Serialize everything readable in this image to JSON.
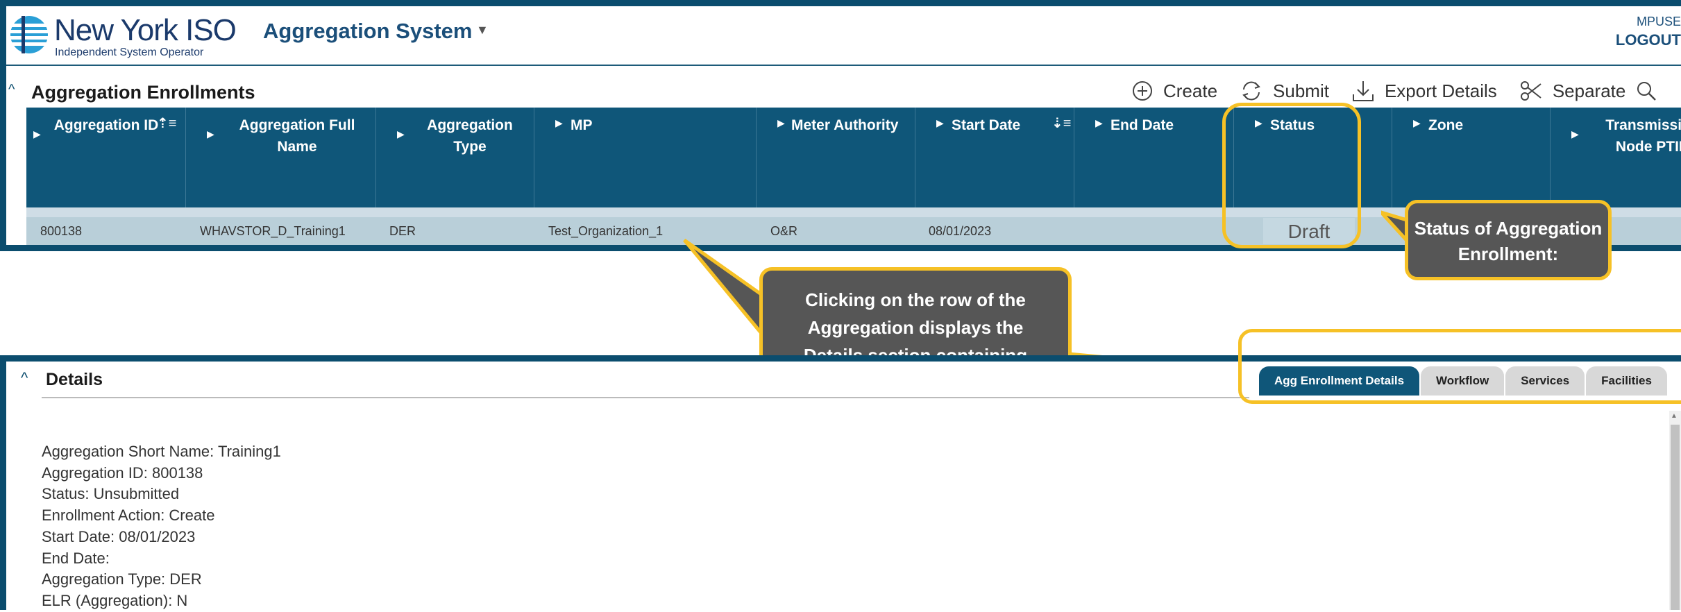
{
  "header": {
    "logo_title": "New York ISO",
    "logo_subtitle": "Independent System Operator",
    "app_title": "Aggregation System",
    "user": "MPUSE",
    "logout": "LOGOUT"
  },
  "enrollments": {
    "title": "Aggregation Enrollments",
    "toolbar": {
      "create": "Create",
      "submit": "Submit",
      "export": "Export Details",
      "separate": "Separate"
    },
    "columns": [
      {
        "label": "Aggregation ID"
      },
      {
        "label": "Aggregation Full Name"
      },
      {
        "label": "Aggregation Type"
      },
      {
        "label": "MP"
      },
      {
        "label": "Meter Authority"
      },
      {
        "label": "Start Date"
      },
      {
        "label": "End Date"
      },
      {
        "label": "Status"
      },
      {
        "label": "Zone"
      },
      {
        "label": "Transmission Node PTID"
      }
    ],
    "row": {
      "id": "800138",
      "full_name": "WHAVSTOR_D_Training1",
      "type": "DER",
      "mp": "Test_Organization_1",
      "meter_authority": "O&R",
      "start_date": "08/01/2023",
      "end_date": "",
      "status": "Draft"
    }
  },
  "callouts": {
    "status": "Status of Aggregation Enrollment:",
    "row_click": "Clicking on  the row of the Aggregation displays the Details section containing Aggregation level and DER facility level information"
  },
  "details": {
    "title": "Details",
    "tabs": [
      "Agg Enrollment Details",
      "Workflow",
      "Services",
      "Facilities"
    ],
    "lines": [
      "Aggregation Short Name: Training1",
      "Aggregation ID: 800138",
      "Status: Unsubmitted",
      "Enrollment Action: Create",
      "Start Date: 08/01/2023",
      "End Date:",
      "Aggregation Type: DER",
      "ELR (Aggregation): N"
    ]
  },
  "colors": {
    "frame": "#0b4d6e",
    "header_bg": "#0f5679",
    "highlight": "#f6c126",
    "callout_bg": "#565656",
    "selected_row": "#b9cfd9"
  }
}
